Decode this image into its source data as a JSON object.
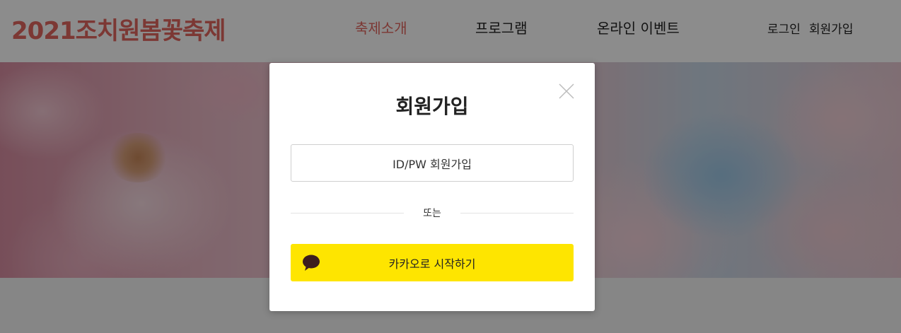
{
  "header": {
    "logo": "2021조치원봄꽃축제",
    "nav": [
      {
        "label": "축제소개",
        "active": true
      },
      {
        "label": "프로그램",
        "active": false
      },
      {
        "label": "온라인 이벤트",
        "active": false
      }
    ],
    "util": {
      "login": "로그인",
      "signup": "회원가입"
    }
  },
  "modal": {
    "title": "회원가입",
    "idpw_button": "ID/PW 회원가입",
    "divider": "또는",
    "kakao_button": "카카오로 시작하기",
    "close_icon": "close-icon",
    "kakao_icon": "speech-bubble-icon"
  },
  "colors": {
    "accent": "#e2665f",
    "kakao": "#fee500",
    "kakao_icon": "#3c1e1e"
  }
}
